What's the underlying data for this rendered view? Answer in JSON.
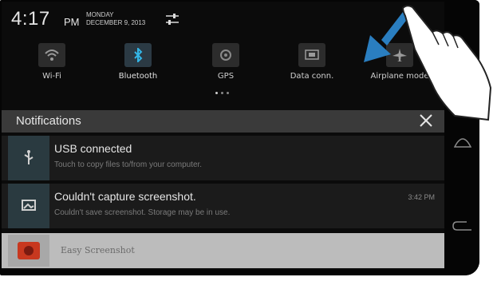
{
  "status": {
    "time": "4:17",
    "ampm": "PM",
    "day": "MONDAY",
    "date": "DECEMBER 9, 2013"
  },
  "quick_settings": [
    {
      "label": "Wi-Fi",
      "icon": "wifi-icon"
    },
    {
      "label": "Bluetooth",
      "icon": "bluetooth-icon",
      "active": true
    },
    {
      "label": "GPS",
      "icon": "gps-icon"
    },
    {
      "label": "Data conn.",
      "icon": "data-connection-icon"
    },
    {
      "label": "Airplane mode",
      "icon": "airplane-icon"
    }
  ],
  "notifications": {
    "title": "Notifications",
    "items": [
      {
        "title": "USB connected",
        "subtitle": "Touch to copy files to/from your computer.",
        "time": "",
        "icon": "usb-icon"
      },
      {
        "title": "Couldn't capture screenshot.",
        "subtitle": "Couldn't save screenshot. Storage may be in use.",
        "time": "3:42 PM",
        "icon": "screenshot-icon"
      },
      {
        "title": "Easy Screenshot",
        "icon": "camera-app-icon"
      }
    ]
  },
  "colors": {
    "accent": "#33b5e5",
    "background": "#0b0b0b",
    "header": "#3a3a3a"
  }
}
